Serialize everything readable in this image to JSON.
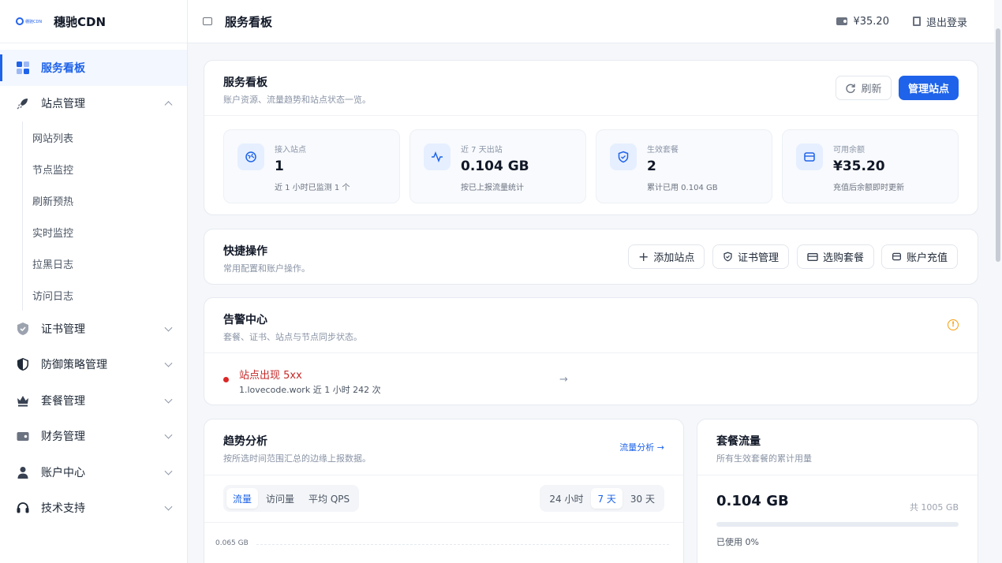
{
  "brand": {
    "logo_text": "穗驰CDN",
    "name": "穗驰CDN"
  },
  "sidebar": {
    "items": [
      {
        "label": "服务看板",
        "icon": "dashboard-icon"
      },
      {
        "label": "站点管理",
        "icon": "rocket-icon"
      },
      {
        "label": "证书管理",
        "icon": "shield-icon"
      },
      {
        "label": "防御策略管理",
        "icon": "shield-half-icon"
      },
      {
        "label": "套餐管理",
        "icon": "crown-icon"
      },
      {
        "label": "财务管理",
        "icon": "wallet-icon"
      },
      {
        "label": "账户中心",
        "icon": "user-icon"
      },
      {
        "label": "技术支持",
        "icon": "headset-icon"
      }
    ],
    "subitems": [
      "网站列表",
      "节点监控",
      "刷新预热",
      "实时监控",
      "拉黑日志",
      "访问日志"
    ]
  },
  "topbar": {
    "title": "服务看板",
    "balance": "¥35.20",
    "logout": "退出登录"
  },
  "overview": {
    "title": "服务看板",
    "subtitle": "账户资源、流量趋势和站点状态一览。",
    "refresh": "刷新",
    "manage": "管理站点",
    "stats": [
      {
        "label": "接入站点",
        "value": "1",
        "note": "近 1 小时已监测 1 个"
      },
      {
        "label": "近 7 天出站",
        "value": "0.104 GB",
        "note": "按已上报流量统计"
      },
      {
        "label": "生效套餐",
        "value": "2",
        "note": "累计已用 0.104 GB"
      },
      {
        "label": "可用余额",
        "value": "¥35.20",
        "note": "充值后余额即时更新"
      }
    ]
  },
  "quick": {
    "title": "快捷操作",
    "subtitle": "常用配置和账户操作。",
    "actions": [
      "添加站点",
      "证书管理",
      "选购套餐",
      "账户充值"
    ]
  },
  "alerts": {
    "title": "告警中心",
    "subtitle": "套餐、证书、站点与节点同步状态。",
    "items": [
      {
        "title": "站点出现 5xx",
        "desc": "1.lovecode.work 近 1 小时 242 次"
      }
    ]
  },
  "trend": {
    "title": "趋势分析",
    "subtitle": "按所选时间范围汇总的边缘上报数据。",
    "link": "流量分析 →",
    "metrics": [
      "流量",
      "访问量",
      "平均 QPS"
    ],
    "ranges": [
      "24 小时",
      "7 天",
      "30 天"
    ],
    "y_tick": "0.065 GB"
  },
  "package": {
    "title": "套餐流量",
    "subtitle": "所有生效套餐的累计用量",
    "used": "0.104 GB",
    "total": "共 1005 GB",
    "percent_label": "已使用 0%",
    "percent": 0.0001
  },
  "colors": {
    "accent": "#1e63e9",
    "danger": "#dc2626",
    "warning": "#f59e0b"
  }
}
